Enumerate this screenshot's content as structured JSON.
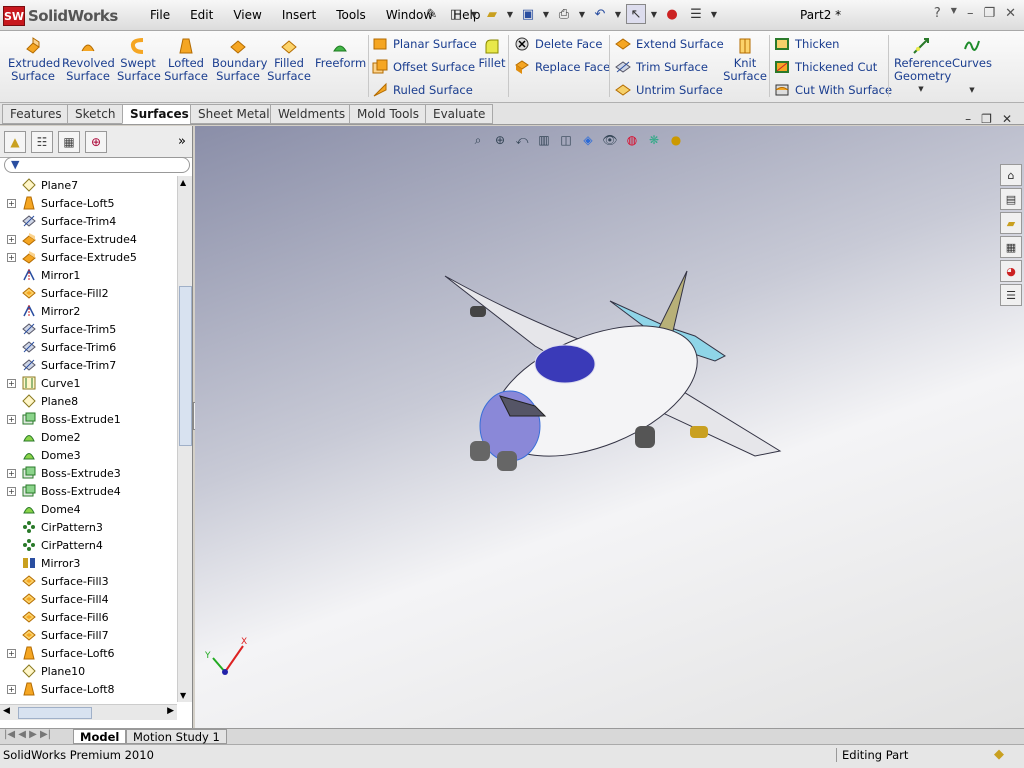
{
  "app": {
    "brand": "SolidWorks",
    "doc_title": "Part2 *"
  },
  "menu": [
    "File",
    "Edit",
    "View",
    "Insert",
    "Tools",
    "Window",
    "Help"
  ],
  "ribbon": {
    "big": [
      {
        "label1": "Extruded",
        "label2": "Surface"
      },
      {
        "label1": "Revolved",
        "label2": "Surface"
      },
      {
        "label1": "Swept",
        "label2": "Surface"
      },
      {
        "label1": "Lofted",
        "label2": "Surface"
      },
      {
        "label1": "Boundary",
        "label2": "Surface"
      },
      {
        "label1": "Filled",
        "label2": "Surface"
      },
      {
        "label1": "Freeform",
        "label2": ""
      }
    ],
    "col1": [
      "Planar Surface",
      "Offset Surface",
      "Ruled Surface"
    ],
    "fillet": "Fillet",
    "col2": [
      "Delete Face",
      "Replace Face"
    ],
    "col3": [
      "Extend Surface",
      "Trim Surface",
      "Untrim Surface"
    ],
    "knit": {
      "label1": "Knit",
      "label2": "Surface"
    },
    "col4": [
      "Thicken",
      "Thickened Cut",
      "Cut With Surface"
    ],
    "refgeo": {
      "label1": "Reference",
      "label2": "Geometry"
    },
    "curves": "Curves"
  },
  "tabs": [
    "Features",
    "Sketch",
    "Surfaces",
    "Sheet Metal",
    "Weldments",
    "Mold Tools",
    "Evaluate"
  ],
  "active_tab": "Surfaces",
  "tree": [
    {
      "name": "Plane7",
      "expand": false,
      "type": "plane"
    },
    {
      "name": "Surface-Loft5",
      "expand": true,
      "type": "loft"
    },
    {
      "name": "Surface-Trim4",
      "expand": false,
      "type": "trim"
    },
    {
      "name": "Surface-Extrude4",
      "expand": true,
      "type": "extrude"
    },
    {
      "name": "Surface-Extrude5",
      "expand": true,
      "type": "extrude"
    },
    {
      "name": "Mirror1",
      "expand": false,
      "type": "mirror"
    },
    {
      "name": "Surface-Fill2",
      "expand": false,
      "type": "fill"
    },
    {
      "name": "Mirror2",
      "expand": false,
      "type": "mirror"
    },
    {
      "name": "Surface-Trim5",
      "expand": false,
      "type": "trim"
    },
    {
      "name": "Surface-Trim6",
      "expand": false,
      "type": "trim"
    },
    {
      "name": "Surface-Trim7",
      "expand": false,
      "type": "trim"
    },
    {
      "name": "Curve1",
      "expand": true,
      "type": "curve"
    },
    {
      "name": "Plane8",
      "expand": false,
      "type": "plane"
    },
    {
      "name": "Boss-Extrude1",
      "expand": true,
      "type": "boss"
    },
    {
      "name": "Dome2",
      "expand": false,
      "type": "dome"
    },
    {
      "name": "Dome3",
      "expand": false,
      "type": "dome"
    },
    {
      "name": "Boss-Extrude3",
      "expand": true,
      "type": "boss"
    },
    {
      "name": "Boss-Extrude4",
      "expand": true,
      "type": "boss"
    },
    {
      "name": "Dome4",
      "expand": false,
      "type": "dome"
    },
    {
      "name": "CirPattern3",
      "expand": false,
      "type": "pattern"
    },
    {
      "name": "CirPattern4",
      "expand": false,
      "type": "pattern"
    },
    {
      "name": "Mirror3",
      "expand": false,
      "type": "mirror3"
    },
    {
      "name": "Surface-Fill3",
      "expand": false,
      "type": "fill"
    },
    {
      "name": "Surface-Fill4",
      "expand": false,
      "type": "fill"
    },
    {
      "name": "Surface-Fill6",
      "expand": false,
      "type": "fill"
    },
    {
      "name": "Surface-Fill7",
      "expand": false,
      "type": "fill"
    },
    {
      "name": "Surface-Loft6",
      "expand": true,
      "type": "loft"
    },
    {
      "name": "Plane10",
      "expand": false,
      "type": "plane"
    },
    {
      "name": "Surface-Loft8",
      "expand": true,
      "type": "loft"
    }
  ],
  "bottom_tabs": [
    "Model",
    "Motion Study 1"
  ],
  "status": {
    "left": "SolidWorks Premium 2010",
    "right": "Editing Part"
  },
  "triad": {
    "x": "X",
    "y": "Y"
  },
  "colors": {
    "accent": "#1a3d8f",
    "logo_red": "#c8181e",
    "selection_blue": "#3a6fd8"
  }
}
